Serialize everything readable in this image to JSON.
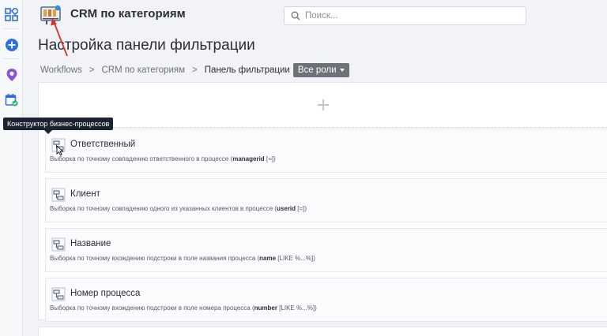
{
  "header": {
    "app_title": "CRM по категориям",
    "search_placeholder": "Поиск..."
  },
  "page": {
    "title": "Настройка панели фильтрации"
  },
  "breadcrumb": {
    "items": [
      "Workflows",
      "CRM по категориям"
    ],
    "current": "Панель фильтрации",
    "roles_button": "Все роли"
  },
  "tooltip": {
    "text": "Конструктор бизнес-процессов"
  },
  "filters": [
    {
      "name": "Ответственный",
      "desc_prefix": "Выборка по точному совпадению ответственного в процессе (",
      "field": "managerid",
      "op": " [=])"
    },
    {
      "name": "Клиент",
      "desc_prefix": "Выборка по точному совпадению одного из указанных клиентов в процессе (",
      "field": "userid",
      "op": " [=])"
    },
    {
      "name": "Название",
      "desc_prefix": "Выборка по точному вхождению подстроки в поле названия процесса (",
      "field": "name",
      "op": " [LIKE %...%])"
    },
    {
      "name": "Номер процесса",
      "desc_prefix": "Выборка по точному вхождению подстроки в поле номера процесса (",
      "field": "number",
      "op": " [LIKE %...%])"
    }
  ],
  "colors": {
    "accent": "#2f6fdb",
    "tooltip_bg": "#1c2330",
    "annotation": "#d9302c"
  },
  "icons": {
    "rail": [
      "apps-grid-icon",
      "add-circle-icon",
      "location-pin-icon",
      "calendar-check-icon"
    ],
    "app": "workflow-board-icon",
    "filter": "process-diagram-icon"
  }
}
